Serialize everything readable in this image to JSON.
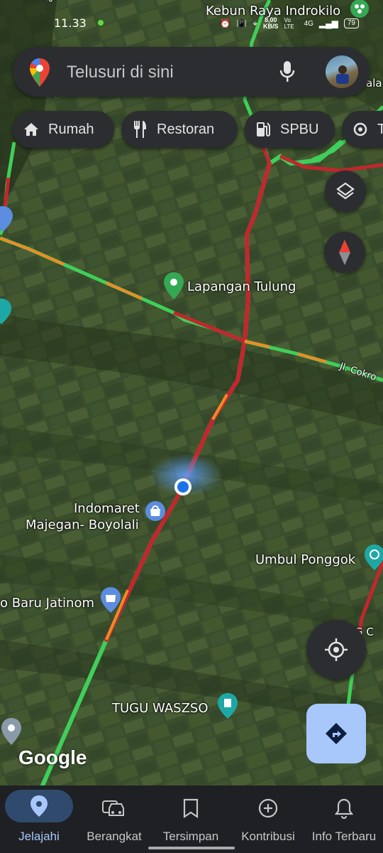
{
  "status_bar": {
    "time": "11.33",
    "speed_value": "8,00",
    "speed_unit": "KB/S",
    "network": "Vo LTE",
    "signal": "4G",
    "battery": "79"
  },
  "search": {
    "placeholder": "Telusuri di sini"
  },
  "chips": [
    {
      "label": "Rumah",
      "icon": "home-icon"
    },
    {
      "label": "Restoran",
      "icon": "restaurant-icon"
    },
    {
      "label": "SPBU",
      "icon": "gas-station-icon"
    },
    {
      "label": "T",
      "icon": "attraction-icon"
    }
  ],
  "map_labels": {
    "kebun_raya": "Kebun Raya Indrokilo",
    "lapangan": "Lapangan Tulung",
    "jl_cokro": "Jl. Cokro",
    "indomaret_line1": "Indomaret",
    "indomaret_line2": "Majegan- Boyolali",
    "umbul": "Umbul Ponggok",
    "baru_jatinom": "o Baru Jatinom",
    "tugu": "TUGU WASZSO",
    "google": "Google",
    "edge_label": "G C",
    "top_left_road": "alay",
    "right_road": "ala"
  },
  "colors": {
    "accent": "#a8c7fa",
    "traffic_green": "#3fcf5a",
    "traffic_orange": "#f08a24",
    "traffic_red": "#c2272d",
    "location_blue": "#1a73e8"
  },
  "nav": [
    {
      "label": "Jelajahi",
      "icon": "explore-pin-icon",
      "active": true
    },
    {
      "label": "Berangkat",
      "icon": "car-icon",
      "active": false
    },
    {
      "label": "Tersimpan",
      "icon": "bookmark-icon",
      "active": false
    },
    {
      "label": "Kontribusi",
      "icon": "add-circle-icon",
      "active": false
    },
    {
      "label": "Info Terbaru",
      "icon": "bell-icon",
      "active": false
    }
  ]
}
